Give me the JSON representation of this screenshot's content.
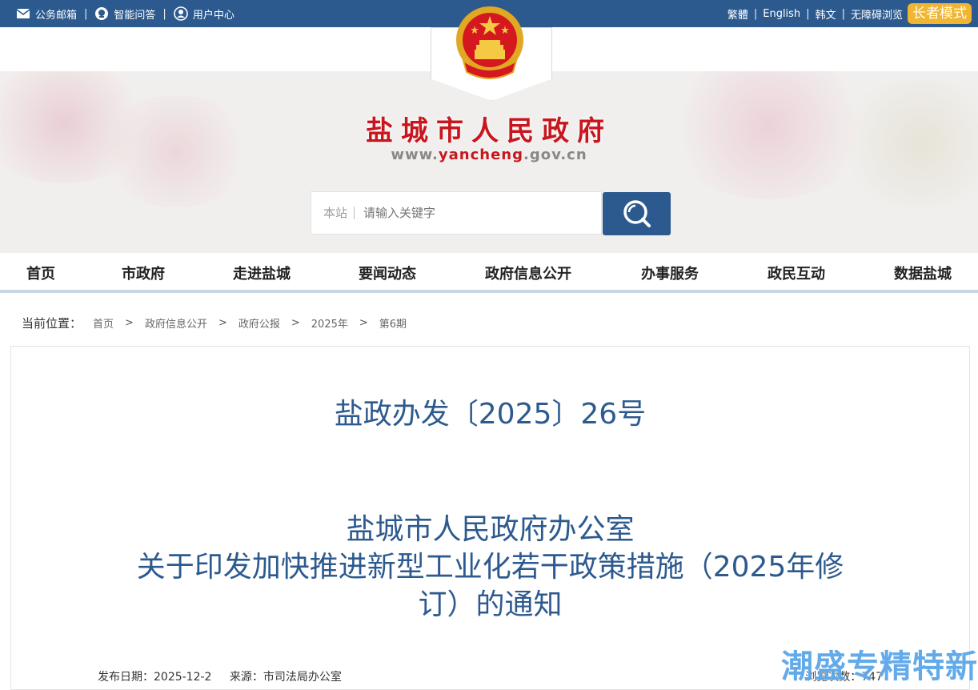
{
  "topbar": {
    "links": [
      "公务邮箱",
      "智能问答",
      "用户中心"
    ],
    "lang": [
      "繁體",
      "English",
      "韩文",
      "无障碍浏览"
    ],
    "elder_mode": "长者模式"
  },
  "header": {
    "title": "盐城市人民政府",
    "url_prefix": "www.",
    "url_highlight": "yancheng",
    "url_suffix": ".gov.cn"
  },
  "search": {
    "scope": "本站",
    "placeholder": "请输入关键字"
  },
  "nav": [
    "首页",
    "市政府",
    "走进盐城",
    "要闻动态",
    "政府信息公开",
    "办事服务",
    "政民互动",
    "数据盐城"
  ],
  "breadcrumb": {
    "label": "当前位置：",
    "items": [
      "首页",
      "政府信息公开",
      "政府公报",
      "2025年",
      "第6期"
    ]
  },
  "article": {
    "doc_number": "盐政办发〔2025〕26号",
    "title_lines": [
      "盐城市人民政府办公室",
      "关于印发加快推进新型工业化若干政策措施（2025年修",
      "订）的通知"
    ],
    "publish_date_label": "发布日期：2025-12-2",
    "source_label": "来源：市司法局办公室",
    "views_label": "浏览次数：747"
  },
  "watermark": "潮盛专精特新",
  "colors": {
    "topbar": "#2d5a8e",
    "accent_red": "#c8161e",
    "elder_button": "#f0b531",
    "title_blue": "#2d5a8e"
  }
}
